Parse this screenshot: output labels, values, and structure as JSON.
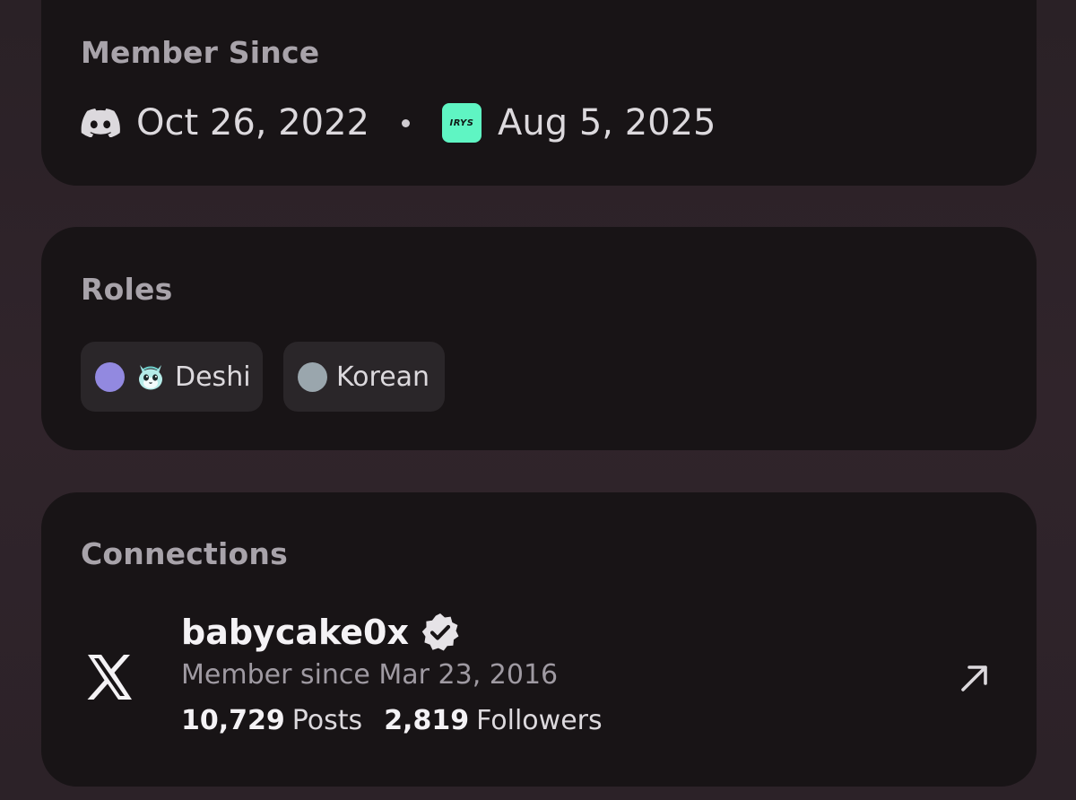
{
  "member_since": {
    "title": "Member Since",
    "discord_icon": "discord-icon",
    "discord_date": "Oct 26, 2022",
    "server_icon_label": "IRYS",
    "server_icon_color": "#5ff5c3",
    "server_date": "Aug 5, 2025"
  },
  "roles": {
    "title": "Roles",
    "items": [
      {
        "label": "Deshi",
        "dot_color": "#9289e0",
        "emoji": "cat-emoji"
      },
      {
        "label": "Korean",
        "dot_color": "#9aa6ad"
      }
    ]
  },
  "connections": {
    "title": "Connections",
    "items": [
      {
        "platform_icon": "x-logo-icon",
        "username": "babycake0x",
        "verified": true,
        "member_since": "Member since Mar 23, 2016",
        "posts_count": "10,729",
        "posts_label": "Posts",
        "followers_count": "2,819",
        "followers_label": "Followers"
      }
    ]
  }
}
